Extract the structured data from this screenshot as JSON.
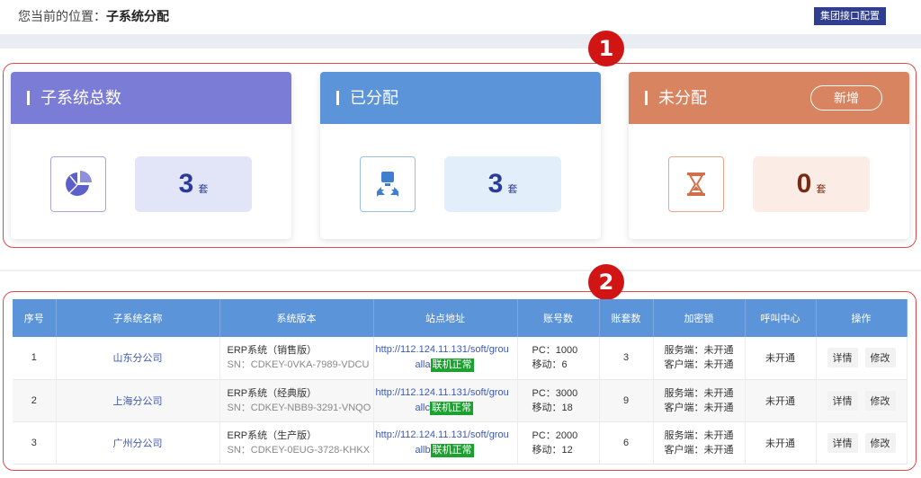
{
  "breadcrumb": {
    "prefix": "您当前的位置：",
    "current": "子系统分配"
  },
  "api_button": "集团接口配置",
  "badges": [
    "1",
    "2"
  ],
  "cards": [
    {
      "title": "子系统总数",
      "count": "3",
      "unit": "套",
      "color": "#7b7cd6",
      "box_color": "#e2e4f8",
      "num_color": "#2a3c97",
      "icon": "pie-chart-icon"
    },
    {
      "title": "已分配",
      "count": "3",
      "unit": "套",
      "color": "#5b94d8",
      "box_color": "#e3eefb",
      "num_color": "#2a3c97",
      "icon": "distribute-icon"
    },
    {
      "title": "未分配",
      "count": "0",
      "unit": "套",
      "color": "#d98460",
      "box_color": "#fcece6",
      "num_color": "#7a2a12",
      "icon": "hourglass-icon",
      "action": "新增"
    }
  ],
  "table": {
    "headers": [
      "序号",
      "子系统名称",
      "系统版本",
      "站点地址",
      "账号数",
      "账套数",
      "加密锁",
      "呼叫中心",
      "操作"
    ],
    "rows": [
      {
        "index": "1",
        "name": "山东分公司",
        "version": "ERP系统（销售版）",
        "sn": "SN：CDKEY-0VKA-7989-VDCU",
        "url": "http://112.124.11.131/soft/grou",
        "url_suffix": "alla",
        "status": "联机正常",
        "pc": "PC：1000",
        "mobile": "移动：6",
        "sets": "3",
        "server": "服务端：未开通",
        "client": "客户端：未开通",
        "call": "未开通",
        "detail": "详情",
        "edit": "修改"
      },
      {
        "index": "2",
        "name": "上海分公司",
        "version": "ERP系统（经典版）",
        "sn": "SN：CDKEY-NBB9-3291-VNQO",
        "url": "http://112.124.11.131/soft/grou",
        "url_suffix": "allc",
        "status": "联机正常",
        "pc": "PC：3000",
        "mobile": "移动：18",
        "sets": "9",
        "server": "服务端：未开通",
        "client": "客户端：未开通",
        "call": "未开通",
        "detail": "详情",
        "edit": "修改"
      },
      {
        "index": "3",
        "name": "广州分公司",
        "version": "ERP系统（生产版）",
        "sn": "SN：CDKEY-0EUG-3728-KHKX",
        "url": "http://112.124.11.131/soft/grou",
        "url_suffix": "allb",
        "status": "联机正常",
        "pc": "PC：2000",
        "mobile": "移动：12",
        "sets": "6",
        "server": "服务端：未开通",
        "client": "客户端：未开通",
        "call": "未开通",
        "detail": "详情",
        "edit": "修改"
      }
    ]
  }
}
